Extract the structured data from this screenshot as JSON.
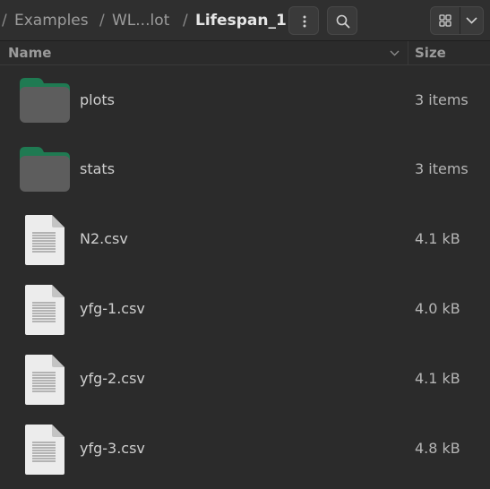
{
  "breadcrumb": {
    "leading_sep": "/",
    "items": [
      {
        "label": "Examples"
      },
      {
        "label": "WL...lot"
      },
      {
        "label": "Lifespan_1"
      }
    ]
  },
  "header": {
    "menu_icon": "vertical-dots-icon",
    "search_icon": "search-icon",
    "view_icon": "grid-view-icon",
    "view_dropdown_icon": "chevron-down-icon"
  },
  "columns": {
    "name": "Name",
    "size": "Size",
    "sort_icon": "chevron-down-icon"
  },
  "files": [
    {
      "name": "plots",
      "size": "3 items",
      "kind": "folder",
      "icon": "folder-icon"
    },
    {
      "name": "stats",
      "size": "3 items",
      "kind": "folder",
      "icon": "folder-icon"
    },
    {
      "name": "N2.csv",
      "size": "4.1 kB",
      "kind": "file",
      "icon": "text-file-icon"
    },
    {
      "name": "yfg-1.csv",
      "size": "4.0 kB",
      "kind": "file",
      "icon": "text-file-icon"
    },
    {
      "name": "yfg-2.csv",
      "size": "4.1 kB",
      "kind": "file",
      "icon": "text-file-icon"
    },
    {
      "name": "yfg-3.csv",
      "size": "4.8 kB",
      "kind": "file",
      "icon": "text-file-icon"
    }
  ],
  "colors": {
    "background": "#2b2b2b",
    "folder_tab": "#1f7a52",
    "folder_body": "#5d5d5d",
    "file_page": "#ececec"
  }
}
